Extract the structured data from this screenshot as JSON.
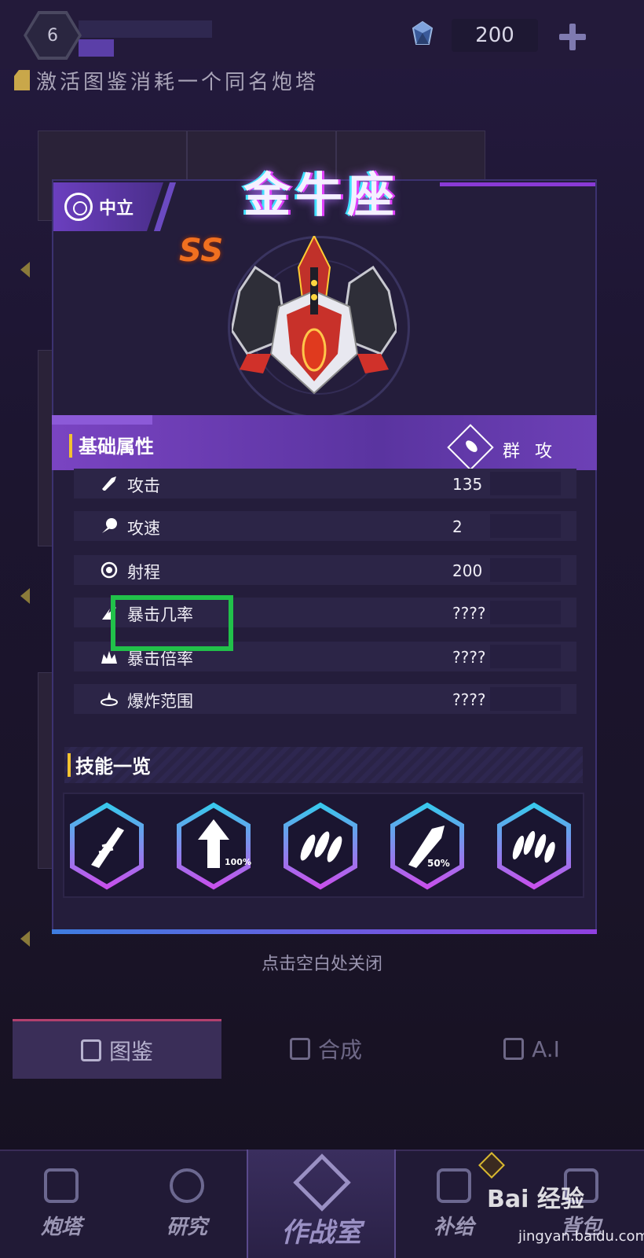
{
  "header": {
    "level": "6",
    "gem_count": "200",
    "notice": "激活图鉴消耗一个同名炮塔"
  },
  "modal": {
    "faction": "中立",
    "title": "金牛座",
    "rank": "SS",
    "section_title": "基础属性",
    "attack_type": "群 攻",
    "stats": [
      {
        "label": "攻击",
        "value": "135",
        "icon": "sword-icon"
      },
      {
        "label": "攻速",
        "value": "2",
        "icon": "speed-icon"
      },
      {
        "label": "射程",
        "value": "200",
        "icon": "target-icon"
      },
      {
        "label": "暴击几率",
        "value": "????",
        "icon": "crit-chance-icon"
      },
      {
        "label": "暴击倍率",
        "value": "????",
        "icon": "crit-multiplier-icon"
      },
      {
        "label": "爆炸范围",
        "value": "????",
        "icon": "explosion-icon"
      }
    ],
    "skills_title": "技能一览",
    "skills": [
      {
        "icon": "feather-missile-icon",
        "badge": ""
      },
      {
        "icon": "arrow-up-icon",
        "badge": "100%"
      },
      {
        "icon": "bullets-icon",
        "badge": ""
      },
      {
        "icon": "rocket-icon",
        "badge": "50%"
      },
      {
        "icon": "multi-missile-icon",
        "badge": ""
      }
    ],
    "close_hint": "点击空白处关闭"
  },
  "tabs": [
    {
      "label": "图鉴",
      "active": true
    },
    {
      "label": "合成",
      "active": false
    },
    {
      "label": "A.I",
      "active": false
    }
  ],
  "nav": [
    {
      "label": "炮塔"
    },
    {
      "label": "研究"
    },
    {
      "label": "作战室"
    },
    {
      "label": "补给"
    },
    {
      "label": "背包"
    }
  ],
  "watermark": {
    "brand": "Bai 经验",
    "url": "jingyan.baidu.com"
  },
  "colors": {
    "accent": "#7a44c2",
    "highlight": "#21c14a",
    "gold": "#f2c230",
    "rank": "#f07020"
  }
}
